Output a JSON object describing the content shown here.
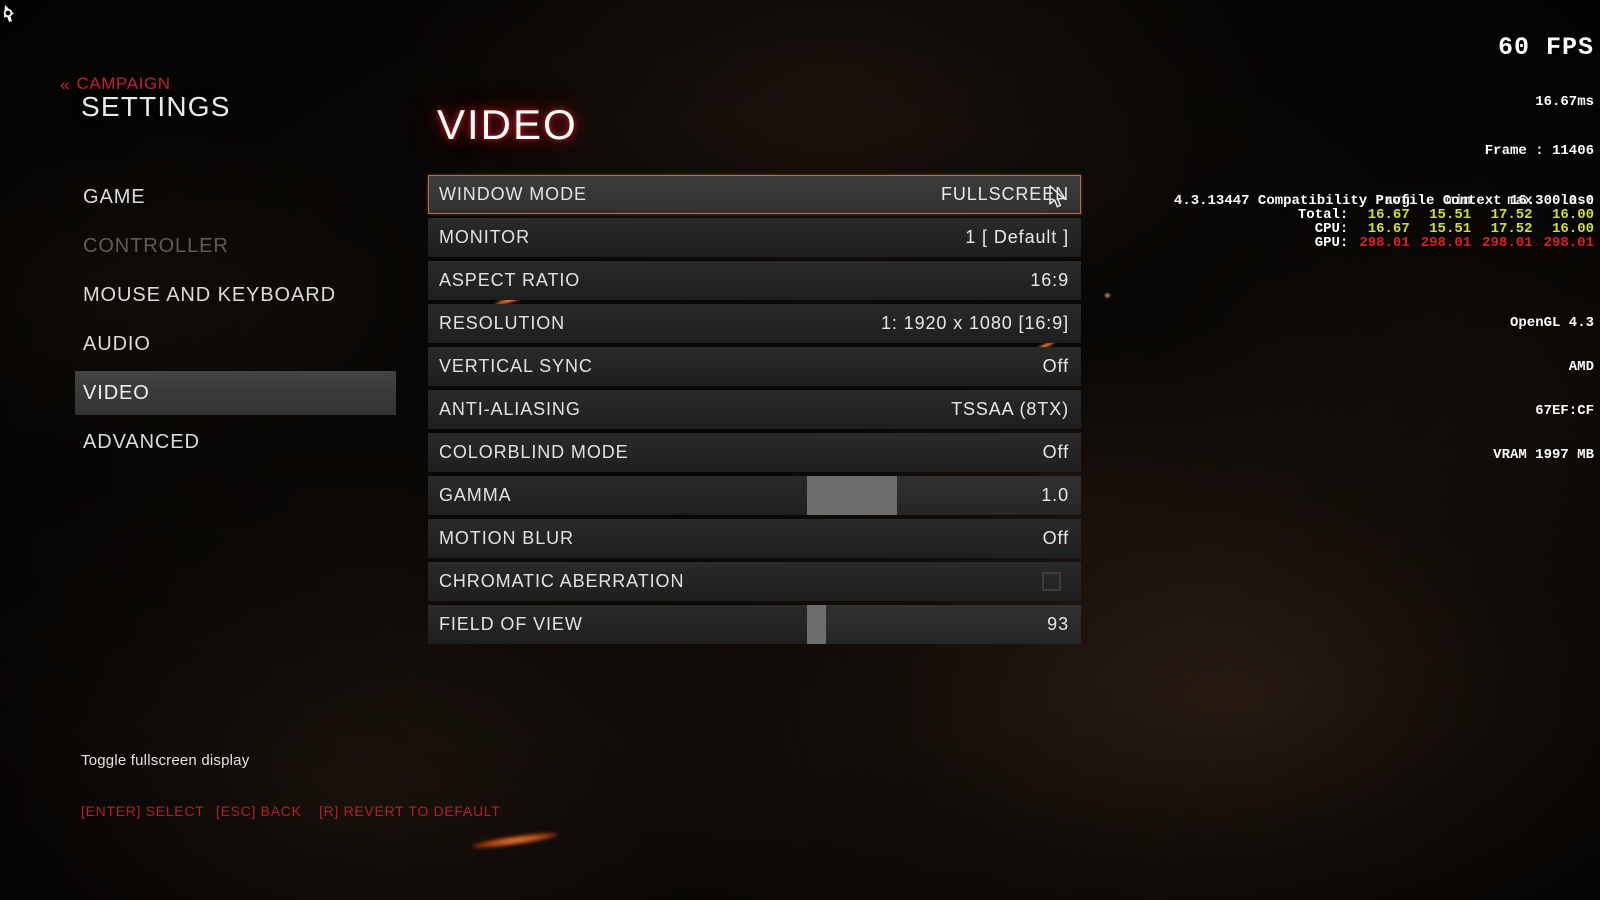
{
  "header": {
    "back_chevrons": "«",
    "back_label": "CAMPAIGN",
    "title": "SETTINGS"
  },
  "section": {
    "title": "VIDEO"
  },
  "sidebar": {
    "items": [
      {
        "label": "GAME",
        "state": "normal"
      },
      {
        "label": "CONTROLLER",
        "state": "disabled"
      },
      {
        "label": "MOUSE AND KEYBOARD",
        "state": "normal"
      },
      {
        "label": "AUDIO",
        "state": "normal"
      },
      {
        "label": "VIDEO",
        "state": "active"
      },
      {
        "label": "ADVANCED",
        "state": "normal"
      }
    ]
  },
  "options": [
    {
      "label": "WINDOW MODE",
      "value": "FULLSCREEN",
      "type": "cycle",
      "selected": true
    },
    {
      "label": "MONITOR",
      "value": "1 [ Default ]",
      "type": "cycle",
      "selected": false
    },
    {
      "label": "ASPECT RATIO",
      "value": "16:9",
      "type": "cycle",
      "selected": false
    },
    {
      "label": "RESOLUTION",
      "value": "1: 1920 x 1080 [16:9]",
      "type": "cycle",
      "selected": false
    },
    {
      "label": "VERTICAL SYNC",
      "value": "Off",
      "type": "cycle",
      "selected": false
    },
    {
      "label": "ANTI-ALIASING",
      "value": "TSSAA (8TX)",
      "type": "cycle",
      "selected": false
    },
    {
      "label": "COLORBLIND MODE",
      "value": "Off",
      "type": "cycle",
      "selected": false
    },
    {
      "label": "GAMMA",
      "value": "1.0",
      "type": "slider",
      "selected": false,
      "fill_pct": 33
    },
    {
      "label": "MOTION BLUR",
      "value": "Off",
      "type": "cycle",
      "selected": false
    },
    {
      "label": "CHROMATIC ABERRATION",
      "value": "",
      "type": "checkbox",
      "selected": false,
      "checked": false
    },
    {
      "label": "FIELD OF VIEW",
      "value": "93",
      "type": "slider",
      "selected": false,
      "fill_pct": 7
    }
  ],
  "footer": {
    "hint": "Toggle fullscreen display",
    "keys": [
      "[ENTER] SELECT",
      "[ESC] BACK",
      "[R] REVERT TO DEFAULT"
    ]
  },
  "perf_overlay": {
    "fps": "60 FPS",
    "frametime": "16.67ms",
    "frame": "Frame : 11406",
    "columns": [
      "avg",
      "min",
      "max",
      "last"
    ],
    "rows": [
      {
        "name": "Total:",
        "avg": "16.67",
        "min": "15.51",
        "max": "17.52",
        "last": "16.00",
        "color": "#d2e02a"
      },
      {
        "name": "CPU:",
        "avg": "16.67",
        "min": "15.51",
        "max": "17.52",
        "last": "16.00",
        "color": "#d2e02a"
      },
      {
        "name": "GPU:",
        "avg": "298.01",
        "min": "298.01",
        "max": "298.01",
        "last": "298.01",
        "color": "#e02020"
      }
    ],
    "api": "OpenGL 4.3",
    "vendor": "AMD",
    "device_id": "67EF:CF",
    "vram": "VRAM 1997 MB",
    "driver_context": "4.3.13447 Compatibility Profile Context 16.300.0.0"
  },
  "colors": {
    "accent_red": "#c1222e",
    "selection_border": "#b5714a",
    "sidebar_active": "#3a3a3a",
    "value_yellow": "#d2e02a",
    "value_red": "#e02020",
    "ember_orange": "#f3722c"
  }
}
